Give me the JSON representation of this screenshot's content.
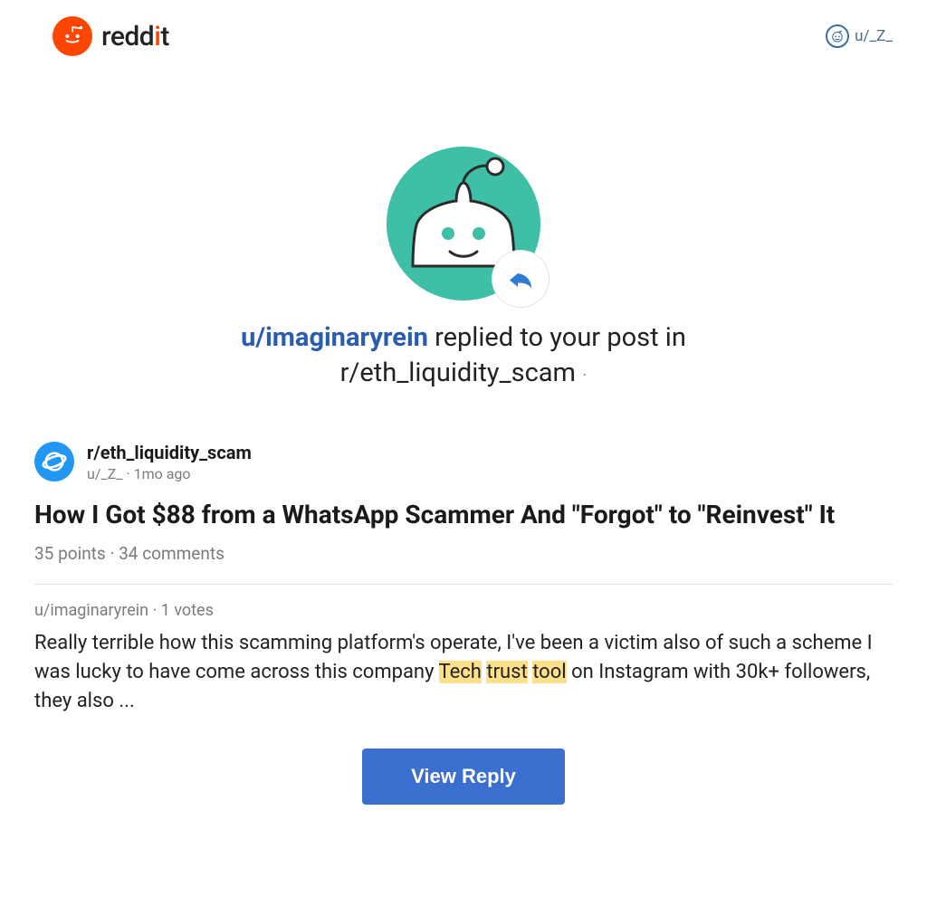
{
  "header": {
    "brand": "reddit",
    "current_user": "u/_Z_"
  },
  "hero": {
    "replier": "u/imaginaryrein",
    "action_text_1": " replied to your post in ",
    "subreddit": "r/eth_liquidity_scam"
  },
  "post": {
    "subreddit": "r/eth_liquidity_scam",
    "author": "u/_Z_",
    "age": "1mo ago",
    "title": "How I Got $88 from a WhatsApp Scammer And \"Forgot\" to \"Reinvest\" It",
    "points": "35 points",
    "comments": "34 comments"
  },
  "reply": {
    "author": "u/imaginaryrein",
    "votes": "1 votes",
    "body_before": "Really terrible how this scamming platform's operate, I've been a victim also of such a scheme I was lucky to have come across this company ",
    "hl1": "Tech",
    "sep1": " ",
    "hl2": "trust",
    "sep2": " ",
    "hl3": "tool",
    "body_after": " on Instagram with 30k+ followers, they also ..."
  },
  "cta": {
    "label": "View Reply"
  }
}
